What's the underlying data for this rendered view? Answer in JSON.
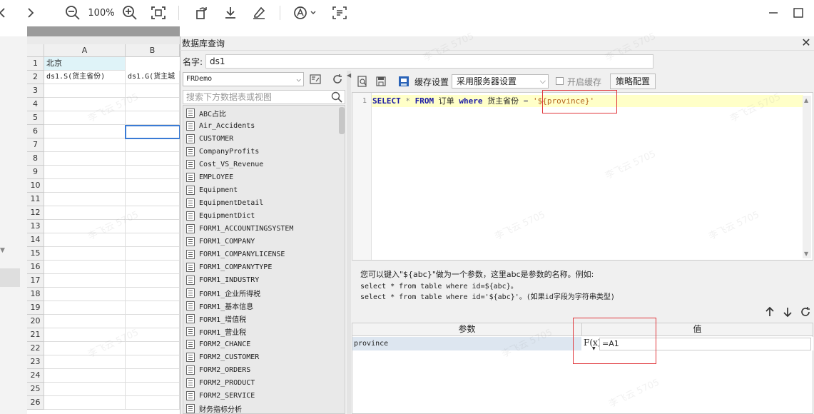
{
  "toolbar": {
    "zoom": "100%",
    "icons": [
      "back-icon",
      "forward-icon",
      "zoom-out-icon",
      "zoom-in-icon",
      "fit-screen-icon",
      "rotate-icon",
      "download-icon",
      "edit-icon",
      "sign-icon",
      "scan-icon",
      "minimize-icon",
      "maximize-icon"
    ]
  },
  "sheet": {
    "columns": [
      "A",
      "B"
    ],
    "rows": [
      "1",
      "2",
      "3",
      "4",
      "5",
      "6",
      "7",
      "8",
      "9",
      "10",
      "11",
      "12",
      "13",
      "14",
      "15",
      "16",
      "17",
      "18",
      "19",
      "20",
      "21",
      "22",
      "23",
      "24",
      "25",
      "26"
    ],
    "a1": "北京",
    "a2": "ds1.S(货主省份)",
    "b2": "ds1.G(货主城"
  },
  "dialog": {
    "title": "数据库查询",
    "name_label": "名字:",
    "name_value": "ds1",
    "db_select": "FRDemo",
    "search_placeholder": "搜索下方数据表或视图",
    "tables": [
      "ABC占比",
      "Air_Accidents",
      "CUSTOMER",
      "CompanyProfits",
      "Cost_VS_Revenue",
      "EMPLOYEE",
      "Equipment",
      "EquipmentDetail",
      "EquipmentDict",
      "FORM1_ACCOUNTINGSYSTEM",
      "FORM1_COMPANY",
      "FORM1_COMPANYLICENSE",
      "FORM1_COMPANYTYPE",
      "FORM1_INDUSTRY",
      "FORM1_企业所得税",
      "FORM1_基本信息",
      "FORM1_增值税",
      "FORM1_营业税",
      "FORM2_CHANCE",
      "FORM2_CUSTOMER",
      "FORM2_ORDERS",
      "FORM2_PRODUCT",
      "FORM2_SERVICE",
      "财务指标分析"
    ],
    "cache_label": "缓存设置",
    "cache_select": "采用服务器设置",
    "enable_cache_label": "开启缓存",
    "strategy_button": "策略配置",
    "sql": {
      "line_no": "1",
      "select": "SELECT",
      "star": "*",
      "from": "FROM",
      "table": "订单",
      "where": "where",
      "field": "货主省份",
      "eq": "=",
      "param": "'${province}'"
    },
    "help_line1": "您可以键入\"${abc}\"做为一个参数，这里abc是参数的名称。例如:",
    "help_line2": "select * from table where id=${abc}。",
    "help_line3": "select * from table where id='${abc}'。(如果id字段为字符串类型)",
    "param_header": "参数",
    "value_header": "值",
    "param_name": "province",
    "param_value": "=A1",
    "fx_label": "F(x)"
  },
  "watermark": "李飞云 5705"
}
